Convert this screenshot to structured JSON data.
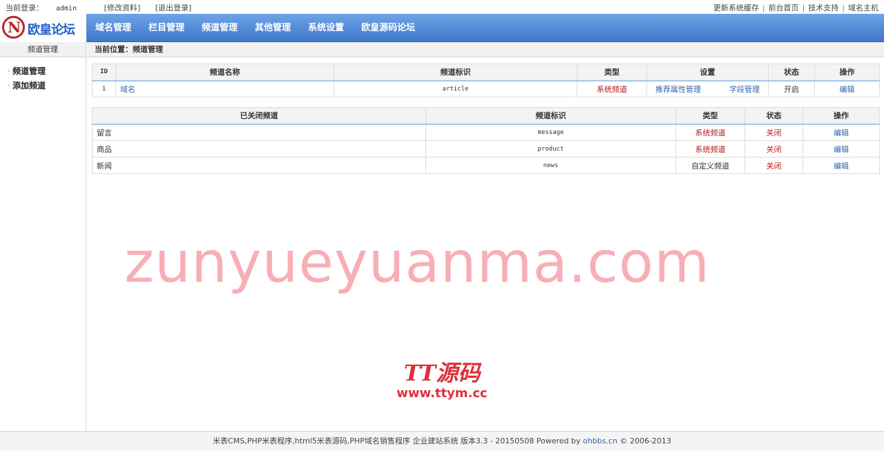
{
  "topbar": {
    "login_label": "当前登录：",
    "username": "admin",
    "edit_profile": "[修改资料]",
    "logout": "[退出登录]",
    "links": [
      "更新系统缓存",
      "前台首页",
      "技术支持",
      "域名主机"
    ]
  },
  "logo": {
    "mark": "N",
    "text": "欧皇论坛"
  },
  "nav": {
    "items": [
      "域名管理",
      "栏目管理",
      "频道管理",
      "其他管理",
      "系统设置",
      "欧皇源码论坛"
    ]
  },
  "sidebar": {
    "title": "频道管理",
    "items": [
      "频道管理",
      "添加频道"
    ]
  },
  "breadcrumb": "当前位置：频道管理",
  "open_channels": {
    "headers": [
      "ID",
      "频道名称",
      "频道标识",
      "类型",
      "设置",
      "状态",
      "操作"
    ],
    "rows": [
      {
        "id": "1",
        "name": "域名",
        "key": "article",
        "type": "系统频道",
        "settings": [
          "推荐属性管理",
          "字段管理"
        ],
        "status": "开启",
        "action": "编辑"
      }
    ]
  },
  "closed_channels": {
    "headers": [
      "已关闭频道",
      "频道标识",
      "类型",
      "状态",
      "操作"
    ],
    "rows": [
      {
        "name": "留言",
        "key": "message",
        "type": "系统频道",
        "status": "关闭",
        "action": "编辑"
      },
      {
        "name": "商品",
        "key": "product",
        "type": "系统频道",
        "status": "关闭",
        "action": "编辑"
      },
      {
        "name": "新闻",
        "key": "news",
        "type": "自定义频道",
        "status": "关闭",
        "action": "编辑"
      }
    ]
  },
  "footer": {
    "text": "米表CMS,PHP米表程序,html5米表源码,PHP域名销售程序  企业建站系统 版本3.3 - 20150508 Powered by",
    "brand": "ohbbs.cn",
    "copyright": "© 2006-2013"
  },
  "watermarks": {
    "main": "zunyueyuanma.com",
    "logo_line1": "TT源码",
    "logo_line2": "www.ttym.cc"
  },
  "colors": {
    "header_blue": "#4a84d6",
    "status_red": "#b11a1a",
    "link_blue": "#3463a8"
  }
}
